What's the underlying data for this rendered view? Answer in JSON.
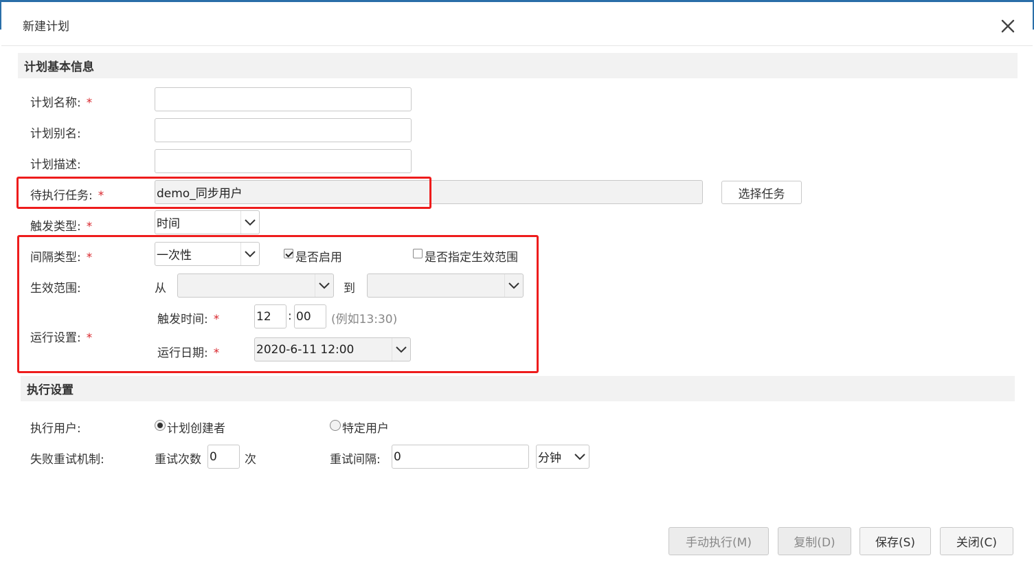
{
  "dialog": {
    "title": "新建计划"
  },
  "sections": {
    "basic": "计划基本信息",
    "exec": "执行设置"
  },
  "fields": {
    "plan_name": {
      "label": "计划名称:",
      "required": "*",
      "value": ""
    },
    "plan_alias": {
      "label": "计划别名:",
      "value": ""
    },
    "plan_desc": {
      "label": "计划描述:",
      "value": ""
    },
    "pending_task": {
      "label": "待执行任务:",
      "required": "*",
      "value": "demo_同步用户",
      "button": "选择任务"
    },
    "trigger_type": {
      "label": "触发类型:",
      "required": "*",
      "value": "时间"
    },
    "interval_type": {
      "label": "间隔类型:",
      "required": "*",
      "value": "一次性",
      "enable_label": "是否启用",
      "enable_checked": true,
      "range_label": "是否指定生效范围",
      "range_checked": false
    },
    "effective_range": {
      "label": "生效范围:",
      "from": "从",
      "to": "到",
      "from_value": "",
      "to_value": ""
    },
    "run_settings": {
      "label": "运行设置:",
      "required": "*",
      "trigger_time_label": "触发时间:",
      "hour": "12",
      "sep": ":",
      "minute": "00",
      "hint": "(例如13:30)",
      "run_date_label": "运行日期:",
      "run_date": "2020-6-11 12:00"
    },
    "exec_user": {
      "label": "执行用户:",
      "opt_creator": "计划创建者",
      "opt_specific": "特定用户",
      "selected": "计划创建者"
    },
    "retry": {
      "label": "失败重试机制:",
      "count_label": "重试次数",
      "count": "0",
      "count_unit": "次",
      "interval_label": "重试间隔:",
      "interval": "0",
      "unit": "分钟"
    }
  },
  "buttons": {
    "manual": "手动执行(M)",
    "copy": "复制(D)",
    "save": "保存(S)",
    "close": "关闭(C)"
  },
  "colors": {
    "highlight": "#ee1c1c",
    "accent": "#2a6ea8",
    "required": "#d9262c"
  }
}
